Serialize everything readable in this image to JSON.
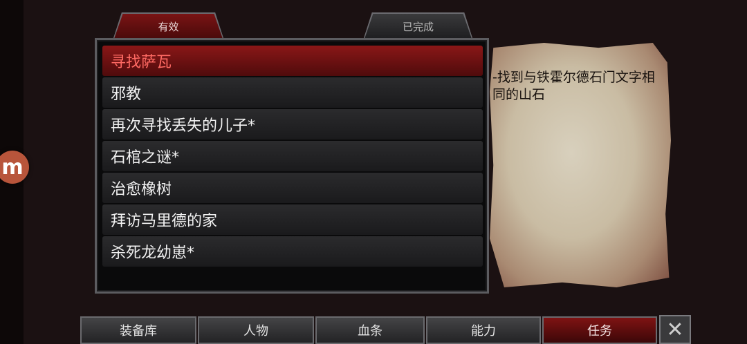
{
  "overlay": {
    "floating_badge": "m"
  },
  "tabs": [
    {
      "label": "有效",
      "active": true
    },
    {
      "label": "已完成",
      "active": false
    }
  ],
  "quests": [
    {
      "label": "寻找萨瓦",
      "selected": true
    },
    {
      "label": "邪教",
      "selected": false
    },
    {
      "label": "再次寻找丢失的儿子*",
      "selected": false
    },
    {
      "label": "石棺之谜*",
      "selected": false
    },
    {
      "label": "治愈橡树",
      "selected": false
    },
    {
      "label": "拜访马里德的家",
      "selected": false
    },
    {
      "label": "杀死龙幼崽*",
      "selected": false
    }
  ],
  "detail": {
    "text": "-找到与铁霍尔德石门文字相同的山石"
  },
  "nav": [
    {
      "label": "装备库",
      "active": false
    },
    {
      "label": "人物",
      "active": false
    },
    {
      "label": "血条",
      "active": false
    },
    {
      "label": "能力",
      "active": false
    },
    {
      "label": "任务",
      "active": true
    }
  ],
  "close_icon": "close-icon",
  "colors": {
    "accent_red": "#8a1717",
    "selected_text": "#ff6a63",
    "parchment": "#c9bca3"
  }
}
